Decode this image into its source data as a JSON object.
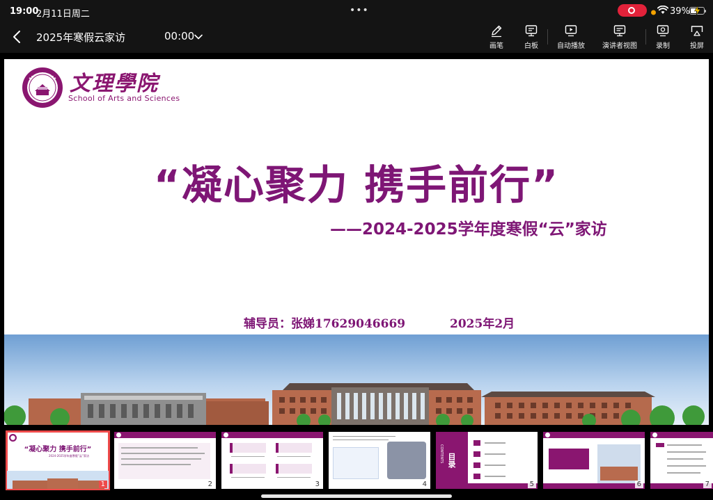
{
  "status_bar": {
    "time": "19:00",
    "date": "2月11日周二",
    "dots": "•••",
    "battery": "39%"
  },
  "toolbar": {
    "title": "2025年寒假云家访",
    "timer": "00:00",
    "tools": [
      {
        "label": "画笔",
        "icon": "pen-icon"
      },
      {
        "label": "白板",
        "icon": "whiteboard-icon"
      },
      {
        "label": "自动播放",
        "icon": "autoplay-icon"
      },
      {
        "label": "演讲者视图",
        "icon": "presenter-view-icon"
      },
      {
        "label": "录制",
        "icon": "record-icon"
      },
      {
        "label": "投屏",
        "icon": "cast-icon"
      }
    ]
  },
  "slide": {
    "logo_cn": "文理學院",
    "logo_en": "School of Arts and Sciences",
    "title": "“凝心聚力 携手前行”",
    "subtitle": "——2024-2025学年度寒假“云”家访",
    "counselor": "辅导员：张娣17629046669",
    "date": "2025年2月"
  },
  "thumbnails": [
    {
      "number": "1",
      "title": "“凝心聚力 携手前行”",
      "subtitle": "2024-2025学年度寒假“云”家访"
    },
    {
      "number": "2"
    },
    {
      "number": "3"
    },
    {
      "number": "4"
    },
    {
      "number": "5",
      "label": "目录",
      "label_en": "CONTENTS"
    },
    {
      "number": "6"
    },
    {
      "number": "7"
    }
  ],
  "colors": {
    "accent": "#7e1675",
    "active_thumb": "#ee4a4a",
    "record": "#e2223a"
  }
}
